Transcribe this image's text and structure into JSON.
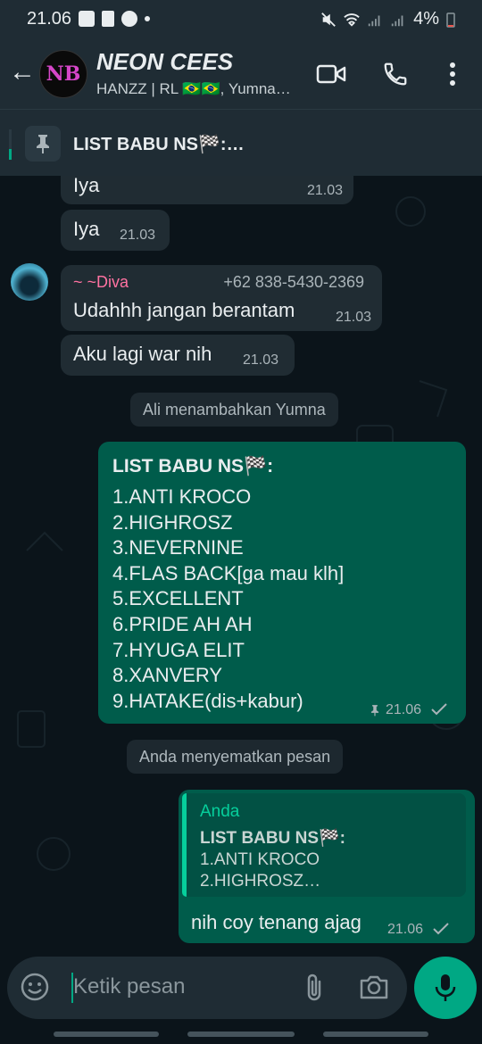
{
  "status_bar": {
    "time": "21.06",
    "battery": "4%"
  },
  "header": {
    "title": "NEON CEES",
    "subtitle": "HANZZ | RL 🇧🇷🇧🇷, Yumna…",
    "avatar_text": "NB"
  },
  "pinned": {
    "text": "LIST BABU NS🏁:…"
  },
  "messages": {
    "m1": {
      "text": "Iya",
      "time": "21.03"
    },
    "m2": {
      "text": "Iya",
      "time": "21.03"
    },
    "m3": {
      "sender": "~ ~Diva",
      "phone": "+62 838-5430-2369",
      "text": "Udahhh jangan berantam",
      "time": "21.03"
    },
    "m4": {
      "text": "Aku lagi war nih",
      "time": "21.03"
    },
    "sys1": "Ali menambahkan Yumna",
    "list": {
      "title": "LIST BABU NS🏁:",
      "items": [
        "1.ANTI KROCO",
        "2.HIGHROSZ",
        "3.NEVERNINE",
        "4.FLAS BACK[ga mau klh]",
        "5.EXCELLENT",
        "6.PRIDE AH AH",
        "7.HYUGA ELIT",
        "8.XANVERY",
        "9.HATAKE(dis+kabur)"
      ],
      "time": "21.06"
    },
    "sys2": "Anda menyematkan pesan",
    "reply": {
      "quote_author": "Anda",
      "quote_title": "LIST BABU NS🏁:",
      "quote_line1": "1.ANTI KROCO",
      "quote_line2": "2.HIGHROSZ…",
      "text": "nih coy tenang ajag",
      "time": "21.06"
    }
  },
  "composer": {
    "placeholder": "Ketik pesan"
  },
  "colors": {
    "accent": "#00a884",
    "outgoing": "#005c4b",
    "incoming": "#202c33",
    "sender_name": "#ff72a1"
  }
}
